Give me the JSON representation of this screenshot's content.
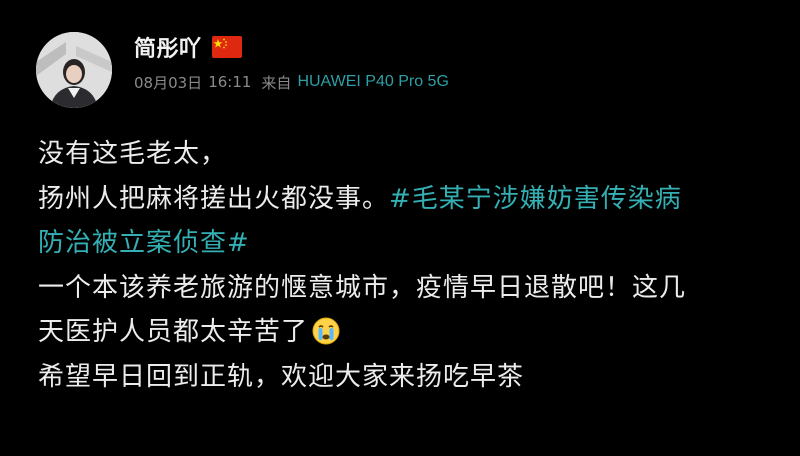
{
  "user": {
    "name": "简彤吖",
    "flag_icon": "china-flag-icon"
  },
  "meta": {
    "date": "08月03日",
    "time": "16:11",
    "from_label": "来自",
    "device": "HUAWEI P40 Pro 5G"
  },
  "content": {
    "line1": "没有这毛老太，",
    "line2_text": "扬州人把麻将搓出火都没事。",
    "line2_hashtag": "#毛某宁涉嫌妨害传染病",
    "line3_hashtag": "防治被立案侦查#",
    "line4": "一个本该养老旅游的惬意城市，疫情早日退散吧！这几",
    "line5_text": "天医护人员都太辛苦了",
    "line5_emoji": "crying-face-icon",
    "line6": "希望早日回到正轨，欢迎大家来扬吃早茶"
  },
  "colors": {
    "background": "#000000",
    "text": "#ececec",
    "meta": "#8a8a8a",
    "accent": "#34b0b4"
  }
}
